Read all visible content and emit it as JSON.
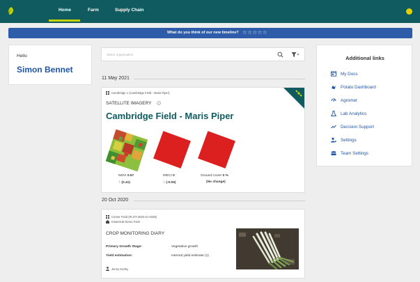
{
  "nav": {
    "items": [
      {
        "label": "Home"
      },
      {
        "label": "Farm"
      },
      {
        "label": "Supply Chain"
      }
    ]
  },
  "banner": {
    "text": "What do you think of our new timeline?",
    "stars": "☆☆☆☆☆"
  },
  "hello": {
    "greeting": "Hello",
    "name": "Simon Bennet"
  },
  "search": {
    "placeholder": "Select organisation"
  },
  "timeline": [
    {
      "date": "11 May 2021",
      "card": {
        "field_ref": "Cambridge 1 (Cambridge Field - Maris Piper)",
        "heading": "SATELLITE IMAGERY",
        "title": "Cambridge Field - Maris Piper",
        "metrics": [
          {
            "label": "NDVI",
            "value": "0.57",
            "change": "(0.41)",
            "arrow": "↑",
            "arrow_color": "#2c8a3c"
          },
          {
            "label": "IRECI",
            "value": "0",
            "change": "(-0.05)",
            "arrow": "↓",
            "arrow_color": "#d42424"
          },
          {
            "label": "Ground Cover",
            "value": "0 %",
            "change": "(No change)",
            "arrow": "",
            "arrow_color": "#333333"
          }
        ]
      }
    },
    {
      "date": "20 Oct 2020",
      "card": {
        "field_ref": "Corner Field (PLOT-2020-21-0336)",
        "farm": "KisanHub Demo Farm",
        "heading": "CROP MONITORING DIARY",
        "rows": [
          {
            "label": "Primary Growth Stage:",
            "value": "Vegetative growth"
          },
          {
            "label": "Yield estimation:",
            "value": "Internal yield estimate (1)"
          }
        ],
        "person": "Jenny Kerley"
      }
    }
  ],
  "links": {
    "title": "Additional links",
    "items": [
      {
        "label": "My Docs",
        "icon": "docs-icon"
      },
      {
        "label": "Potato Dashboard",
        "icon": "potato-icon"
      },
      {
        "label": "Agromet",
        "icon": "agromet-icon"
      },
      {
        "label": "Lab Analytics",
        "icon": "flask-icon"
      },
      {
        "label": "Decision Support",
        "icon": "decision-icon"
      },
      {
        "label": "Settings",
        "icon": "user-settings-icon"
      },
      {
        "label": "Team Settings",
        "icon": "team-icon"
      }
    ]
  },
  "colors": {
    "brand": "#0f5b5f",
    "accent": "#c5d000",
    "banner": "#2e5ca8",
    "link": "#1f55a5"
  }
}
